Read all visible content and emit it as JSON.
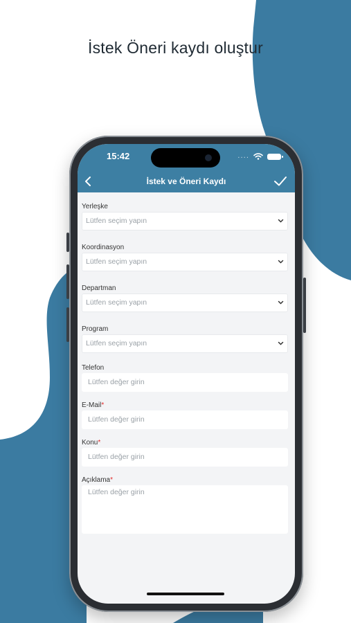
{
  "headline": "İstek Öneri kaydı oluştur",
  "status_bar": {
    "time": "15:42",
    "signal_dots": "...."
  },
  "nav": {
    "title": "İstek ve Öneri Kaydı"
  },
  "form": {
    "selects": [
      {
        "label": "Yerleşke",
        "placeholder": "Lütfen seçim yapın"
      },
      {
        "label": "Koordinasyon",
        "placeholder": "Lütfen seçim yapın"
      },
      {
        "label": "Departman",
        "placeholder": "Lütfen seçim yapın"
      },
      {
        "label": "Program",
        "placeholder": "Lütfen seçim yapın"
      }
    ],
    "telefon": {
      "label": "Telefon",
      "placeholder": "Lütfen değer girin"
    },
    "email": {
      "label": "E-Mail",
      "required_mark": "*",
      "placeholder": "Lütfen değer girin"
    },
    "konu": {
      "label": "Konu",
      "required_mark": "*",
      "placeholder": "Lütfen değer girin"
    },
    "aciklama": {
      "label": "Açıklama",
      "required_mark": "*",
      "placeholder": "Lütfen değer girin"
    }
  },
  "colors": {
    "accent": "#3d7fa3",
    "blob": "#3b7ba1",
    "required": "#e02a2a"
  },
  "icons": [
    "back-chevron-icon",
    "checkmark-icon",
    "wifi-icon",
    "battery-icon",
    "chevron-down-icon"
  ]
}
